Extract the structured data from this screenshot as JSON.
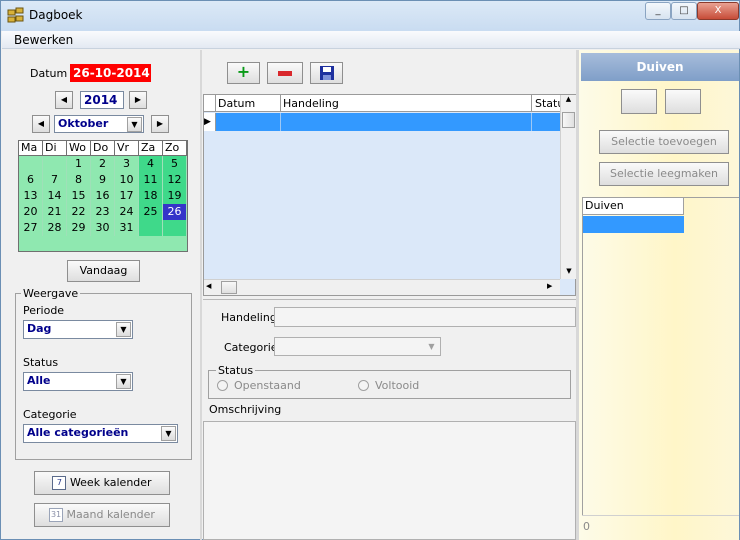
{
  "window": {
    "title": "Dagboek",
    "minimize": "_",
    "maximize": "□",
    "close": "X"
  },
  "menu": {
    "items": [
      "Bewerken"
    ]
  },
  "left": {
    "datum_label": "Datum",
    "datum_value": "26-10-2014",
    "year": "2014",
    "month": "Oktober",
    "weekdays": [
      "Ma",
      "Di",
      "Wo",
      "Do",
      "Vr",
      "Za",
      "Zo"
    ],
    "weeks": [
      [
        "",
        "",
        "1",
        "2",
        "3",
        "4",
        "5"
      ],
      [
        "6",
        "7",
        "8",
        "9",
        "10",
        "11",
        "12"
      ],
      [
        "13",
        "14",
        "15",
        "16",
        "17",
        "18",
        "19"
      ],
      [
        "20",
        "21",
        "22",
        "23",
        "24",
        "25",
        "26"
      ],
      [
        "27",
        "28",
        "29",
        "30",
        "31",
        "",
        ""
      ]
    ],
    "selected_day": "26",
    "today_button": "Vandaag",
    "weergave": {
      "title": "Weergave",
      "periode_label": "Periode",
      "periode_value": "Dag",
      "status_label": "Status",
      "status_value": "Alle",
      "categorie_label": "Categorie",
      "categorie_value": "Alle categorieën"
    },
    "week_button": "Week kalender",
    "maand_button": "Maand kalender",
    "week_icon_num": "7",
    "maand_icon_num": "31"
  },
  "toolbar": {
    "add": "+",
    "remove": "−"
  },
  "table": {
    "columns": [
      "Datum",
      "Handeling",
      "Statu"
    ]
  },
  "detail": {
    "handeling_label": "Handeling",
    "categorie_label": "Categorie",
    "status_group": "Status",
    "openstaand": "Openstaand",
    "voltooid": "Voltooid",
    "omschrijving_label": "Omschrijving"
  },
  "right": {
    "title": "Duiven",
    "selectie_toevoegen": "Selectie toevoegen",
    "selectie_leegmaken": "Selectie leegmaken",
    "column": "Duiven",
    "footer_value": "0"
  },
  "colors": {
    "datum_bg": "#ff0000",
    "calendar_bg": "#8fe8b0",
    "weekend": "#3fd98a",
    "selected": "#3535c9",
    "row_selected": "#3399ff",
    "grid_bg": "#dbe8f9"
  }
}
